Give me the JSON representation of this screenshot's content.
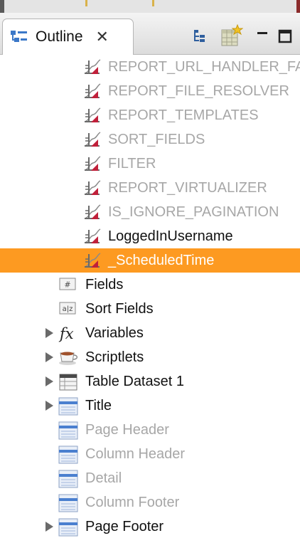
{
  "view": {
    "tab_title": "Outline",
    "tab_icon": "outline-icon",
    "close_icon": "close-icon",
    "toolbar": [
      "tree-layout-icon",
      "datasource-icon",
      "minimize-icon",
      "maximize-icon"
    ]
  },
  "params": [
    {
      "label": "REPORT_URL_HANDLER_FACTORY",
      "icon": "parameter-icon",
      "enabled": false,
      "selected": false
    },
    {
      "label": "REPORT_FILE_RESOLVER",
      "icon": "parameter-icon",
      "enabled": false,
      "selected": false
    },
    {
      "label": "REPORT_TEMPLATES",
      "icon": "parameter-icon",
      "enabled": false,
      "selected": false
    },
    {
      "label": "SORT_FIELDS",
      "icon": "parameter-icon",
      "enabled": false,
      "selected": false
    },
    {
      "label": "FILTER",
      "icon": "parameter-icon",
      "enabled": false,
      "selected": false
    },
    {
      "label": "REPORT_VIRTUALIZER",
      "icon": "parameter-icon",
      "enabled": false,
      "selected": false
    },
    {
      "label": "IS_IGNORE_PAGINATION",
      "icon": "parameter-icon",
      "enabled": false,
      "selected": false
    },
    {
      "label": "LoggedInUsername",
      "icon": "parameter-icon",
      "enabled": true,
      "selected": false
    },
    {
      "label": "_ScheduledTime",
      "icon": "parameter-icon",
      "enabled": true,
      "selected": true
    }
  ],
  "nodes": [
    {
      "label": "Fields",
      "icon": "fields-icon",
      "expandable": false,
      "enabled": true
    },
    {
      "label": "Sort Fields",
      "icon": "sort-fields-icon",
      "expandable": false,
      "enabled": true
    },
    {
      "label": "Variables",
      "icon": "function-icon",
      "expandable": true,
      "enabled": true
    },
    {
      "label": "Scriptlets",
      "icon": "coffee-cup-icon",
      "expandable": true,
      "enabled": true
    },
    {
      "label": "Table Dataset 1",
      "icon": "table-dataset-icon",
      "expandable": true,
      "enabled": true
    },
    {
      "label": "Title",
      "icon": "band-icon",
      "expandable": true,
      "enabled": true
    },
    {
      "label": "Page Header",
      "icon": "band-icon",
      "expandable": false,
      "enabled": false
    },
    {
      "label": "Column Header",
      "icon": "band-icon",
      "expandable": false,
      "enabled": false
    },
    {
      "label": "Detail",
      "icon": "band-icon",
      "expandable": false,
      "enabled": false
    },
    {
      "label": "Column Footer",
      "icon": "band-icon",
      "expandable": false,
      "enabled": false
    },
    {
      "label": "Page Footer",
      "icon": "band-icon",
      "expandable": true,
      "enabled": true
    }
  ],
  "colors": {
    "selection": "#fd9a21",
    "disabled_text": "#a7a7a7",
    "text": "#111111"
  }
}
